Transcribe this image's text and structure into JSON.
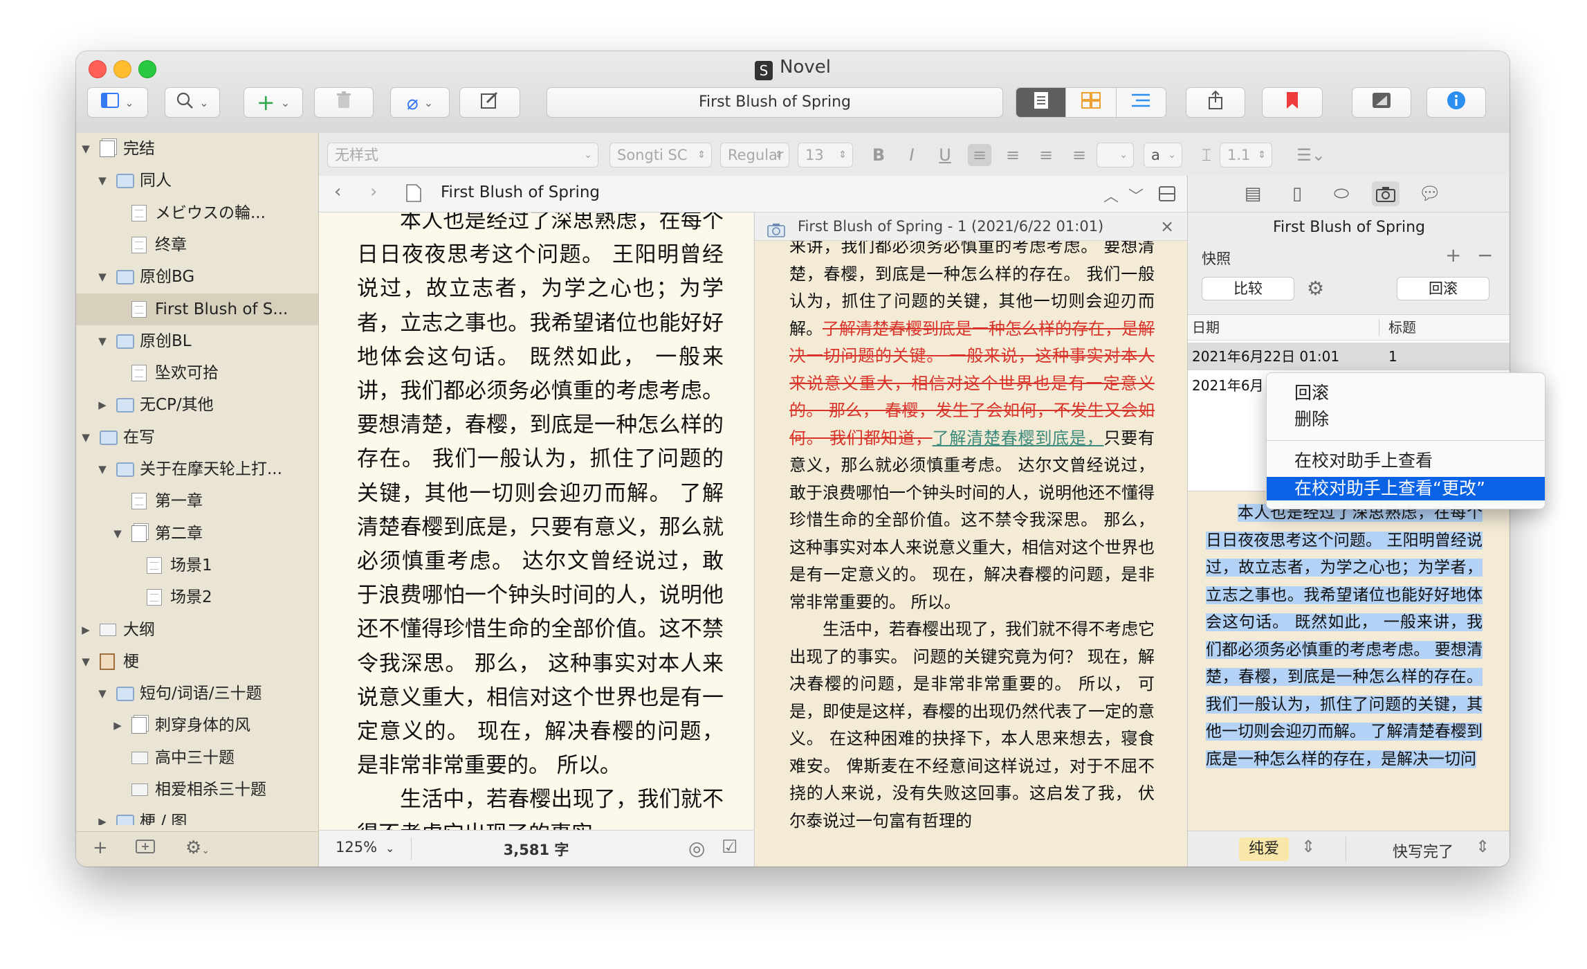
{
  "window": {
    "title": "Novel",
    "app_icon": "S"
  },
  "toolbar": {
    "document_title": "First Blush of Spring"
  },
  "binder": {
    "items": [
      {
        "label": "完结",
        "level": 0,
        "icon": "docs",
        "disclosure": "open"
      },
      {
        "label": "同人",
        "level": 1,
        "icon": "folder",
        "disclosure": "open"
      },
      {
        "label": "メビウスの輪...",
        "level": 2,
        "icon": "doc",
        "disclosure": ""
      },
      {
        "label": "终章",
        "level": 2,
        "icon": "doc",
        "disclosure": ""
      },
      {
        "label": "原创BG",
        "level": 1,
        "icon": "folder",
        "disclosure": "open"
      },
      {
        "label": "First Blush of S...",
        "level": 2,
        "icon": "doc",
        "disclosure": "",
        "selected": true
      },
      {
        "label": "原创BL",
        "level": 1,
        "icon": "folder",
        "disclosure": "open"
      },
      {
        "label": "坠欢可拾",
        "level": 2,
        "icon": "doc",
        "disclosure": ""
      },
      {
        "label": "无CP/其他",
        "level": 1,
        "icon": "folder",
        "disclosure": "closed"
      },
      {
        "label": "在写",
        "level": 0,
        "icon": "folder",
        "disclosure": "open"
      },
      {
        "label": "关于在摩天轮上打...",
        "level": 1,
        "icon": "folder",
        "disclosure": "open"
      },
      {
        "label": "第一章",
        "level": 2,
        "icon": "doc",
        "disclosure": ""
      },
      {
        "label": "第二章",
        "level": 2,
        "icon": "docs",
        "disclosure": "open"
      },
      {
        "label": "场景1",
        "level": 3,
        "icon": "doc",
        "disclosure": ""
      },
      {
        "label": "场景2",
        "level": 3,
        "icon": "doc",
        "disclosure": ""
      },
      {
        "label": "大纲",
        "level": 0,
        "icon": "card",
        "disclosure": "closed"
      },
      {
        "label": "梗",
        "level": 0,
        "icon": "board",
        "disclosure": "open"
      },
      {
        "label": "短句/词语/三十题",
        "level": 1,
        "icon": "folder",
        "disclosure": "open"
      },
      {
        "label": "刺穿身体的风",
        "level": 2,
        "icon": "docs",
        "disclosure": "closed"
      },
      {
        "label": "高中三十题",
        "level": 2,
        "icon": "card",
        "disclosure": ""
      },
      {
        "label": "相爱相杀三十题",
        "level": 2,
        "icon": "card",
        "disclosure": ""
      },
      {
        "label": "梗 / 图",
        "level": 1,
        "icon": "folder",
        "disclosure": "closed"
      }
    ]
  },
  "format_bar": {
    "style": "无样式",
    "font": "Songti SC",
    "weight": "Regular",
    "size": "13",
    "bold": "B",
    "italic": "I",
    "underline": "U",
    "text_color": "a",
    "line_spacing": "1.1"
  },
  "editor": {
    "doc_title": "First Blush of Spring",
    "paragraphs": [
      {
        "text": "本人也是经过了深思熟虑，在每个日日夜夜思考这个问题。 王阳明曾经说过，故立志者，为学之心也；为学者，立志之事也。我希望诸位也能好好地体会这句话。 既然如此， 一般来讲，我们都必须务必慎重的考虑考虑。 要想清楚，春樱，到底是一种怎么样的存在。 我们一般认为，抓住了问题的关键，其他一切则会迎刃而解。 了解清楚春樱到底是，只要有意义，那么就必须慎重考虑。 达尔文曾经说过，敢于浪费哪怕一个钟头时间的人，说明他还不懂得珍惜生命的全部价值。这不禁令我深思。 那么， 这种事实对本人来说意义重大，相信对这个世界也是有一定意义的。 现在，解决春樱的问题，是非常非常重要的。 所以。",
        "indent": true
      },
      {
        "text": "生活中，若春樱出现了，我们就不得不考虑它出现了的事实。",
        "indent": true
      }
    ],
    "zoom": "125%",
    "word_count": "3,581 字"
  },
  "snapshot_view": {
    "title": "First Blush of Spring - 1 (2021/6/22 01:01)",
    "p1_before": "来讲，我们都必须务必慎重的考虑考虑。 要想清楚，春樱，到底是一种怎么样的存在。 我们一般认为，抓住了问题的关键，其他一切则会迎刃而解。",
    "p1_deleted": "了解清楚春樱到底是一种怎么样的存在，是解决一切问题的关键。 一般来说，这种事实对本人来说意义重大，相信对这个世界也是有一定意义的。 那么， 春樱，发生了会如何，不发生又会如何。 我们都知道，",
    "p1_inserted": "了解清楚春樱到底是，",
    "p1_after": "只要有意义，那么就必须慎重考虑。 达尔文曾经说过，敢于浪费哪怕一个钟头时间的人，说明他还不懂得珍惜生命的全部价值。这不禁令我深思。 那么， 这种事实对本人来说意义重大，相信对这个世界也是有一定意义的。 现在，解决春樱的问题，是非常非常重要的。 所以。",
    "p2": "生活中，若春樱出现了，我们就不得不考虑它出现了的事实。 问题的关键究竟为何？ 现在，解决春樱的问题，是非常非常重要的。 所以， 可是，即使是这样，春樱的出现仍然代表了一定的意义。 在这种困难的抉择下，本人思来想去，寝食难安。 俾斯麦在不经意间这样说过，对于不屈不挠的人来说，没有失败这回事。这启发了我， 伏尔泰说过一句富有哲理的"
  },
  "inspector": {
    "title": "First Blush of Spring",
    "section": "快照",
    "compare_label": "比较",
    "rollback_label": "回滚",
    "columns": {
      "date": "日期",
      "title": "标题"
    },
    "rows": [
      {
        "date": "2021年6月22日 01:01",
        "title": "1"
      },
      {
        "date": "2021年6月",
        "title": ""
      }
    ],
    "preview_text": "本人也是经过了深思熟虑，在每个日日夜夜思考这个问题。 王阳明曾经说过，故立志者，为学之心也；为学者，立志之事也。我希望诸位也能好好地体会这句话。 既然如此， 一般来讲，我们都必须务必慎重的考虑考虑。 要想清楚，春樱，到底是一种怎么样的存在。 我们一般认为，抓住了问题的关键，其他一切则会迎刃而解。 了解清楚春樱到底是一种怎么样的存在，是解决一切问",
    "label_value": "纯爱",
    "status_value": "快写完了"
  },
  "context_menu": {
    "items": [
      "回滚",
      "删除",
      "在校对助手上查看",
      "在校对助手上查看“更改”"
    ]
  },
  "colors": {
    "highlight": "#0a62e4",
    "deleted": "#d9342b",
    "inserted": "#3b8a7c",
    "binder_bg": "#e9e4d4",
    "editor_bg": "#fcf8ea"
  }
}
